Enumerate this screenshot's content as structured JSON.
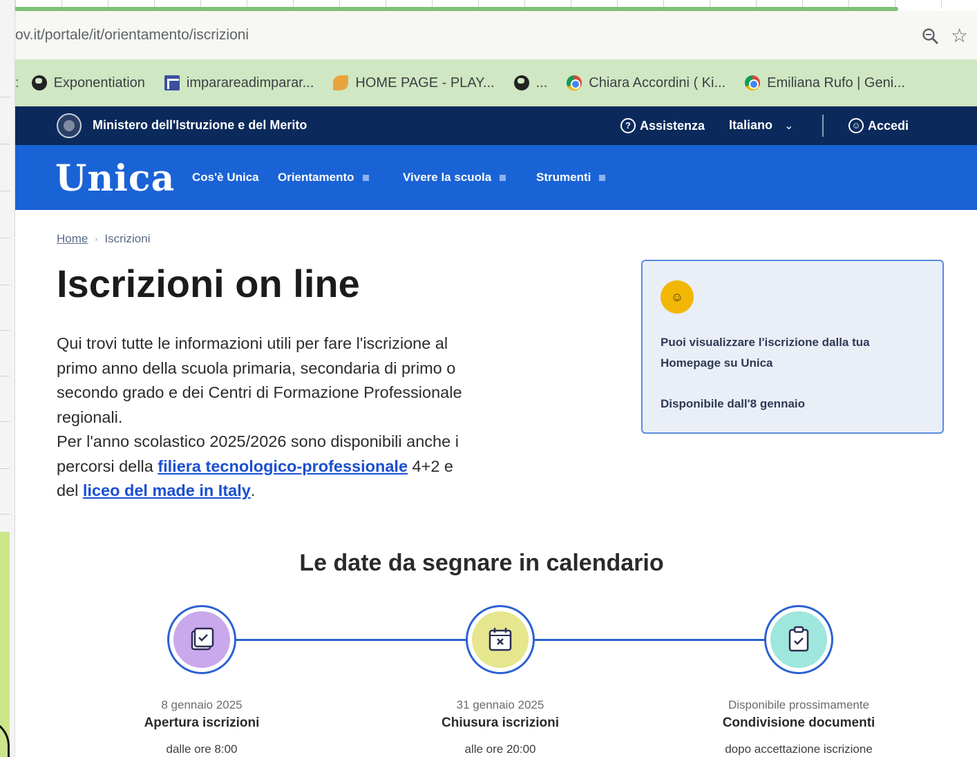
{
  "browser": {
    "url": "ov.it/portale/it/orientamento/iscrizioni",
    "bookmarks": [
      {
        "label": "Exponentiation",
        "icon": "globe-icon"
      },
      {
        "label": "impararea​dimparar...",
        "icon": "grid-icon"
      },
      {
        "label": "HOME PAGE - PLAY...",
        "icon": "leaf-icon"
      },
      {
        "label": "...",
        "icon": "globe-icon"
      },
      {
        "label": "Chiara Accordini ( Ki...",
        "icon": "chrome-icon"
      },
      {
        "label": "Emiliana Rufo | Geni...",
        "icon": "chrome-icon"
      }
    ]
  },
  "ministry": {
    "name": "Ministero dell'Istruzione e del Merito",
    "assist": "Assistenza",
    "language": "Italiano",
    "login": "Accedi"
  },
  "nav": {
    "logo": "Unica",
    "items": [
      "Cos'è Unica",
      "Orientamento",
      "Vivere la scuola",
      "Strumenti"
    ]
  },
  "breadcrumb": {
    "home": "Home",
    "current": "Iscrizioni"
  },
  "page": {
    "title": "Iscrizioni on line",
    "intro_1": "Qui trovi tutte le informazioni utili per fare l'iscrizione al primo anno della scuola primaria, secondaria di primo o secondo grado e dei Centri di Formazione Professionale regionali.",
    "intro_2": "Per l'anno scolastico 2025/2026 sono disponibili anche i percorsi della ",
    "link_1": "filiera tecnologico-professionale",
    "intro_3": " 4+2 e del ",
    "link_2": "liceo del made in Italy",
    "intro_4": "."
  },
  "card": {
    "text": "Puoi visualizzare l'iscrizione dalla tua Homepage su Unica",
    "available": "Disponibile dall'8 gennaio"
  },
  "calendar": {
    "title": "Le date da segnare in calendario",
    "steps": [
      {
        "date": "8 gennaio 2025",
        "title": "Apertura iscrizioni",
        "note": "dalle ore 8:00",
        "color": "#c9a8ec",
        "icon": "calendar-check-icon"
      },
      {
        "date": "31 gennaio 2025",
        "title": "Chiusura iscrizioni",
        "note": "alle ore 20:00",
        "color": "#e6e68f",
        "icon": "calendar-x-icon"
      },
      {
        "date": "Disponibile prossimamente",
        "title": "Condivisione documenti",
        "note": "dopo accettazione iscrizione",
        "color": "#9fe6dc",
        "icon": "clipboard-check-icon"
      }
    ]
  }
}
